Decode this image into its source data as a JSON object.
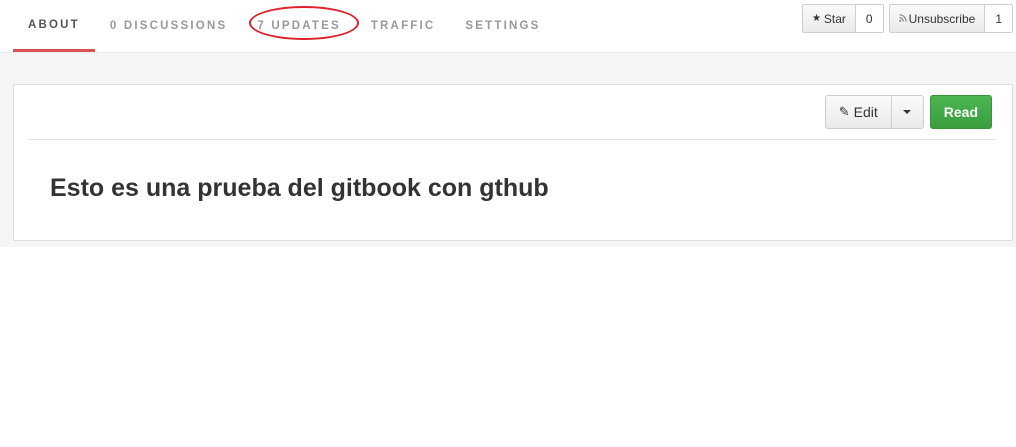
{
  "nav": {
    "tabs": [
      {
        "label": "ABOUT"
      },
      {
        "label": "0 DISCUSSIONS"
      },
      {
        "label": "7 UPDATES"
      },
      {
        "label": "TRAFFIC"
      },
      {
        "label": "SETTINGS"
      }
    ],
    "active_color": "#d9534f",
    "annotation_color": "#e0202a"
  },
  "actions": {
    "star": {
      "label": "Star",
      "count": "0",
      "icon": "star-icon"
    },
    "unsubscribe": {
      "label": "Unsubscribe",
      "count": "1",
      "icon": "rss-icon"
    }
  },
  "card": {
    "edit_label": "Edit",
    "read_label": "Read",
    "read_color": "#43a947",
    "title": "Esto es una prueba del gitbook con gthub"
  }
}
